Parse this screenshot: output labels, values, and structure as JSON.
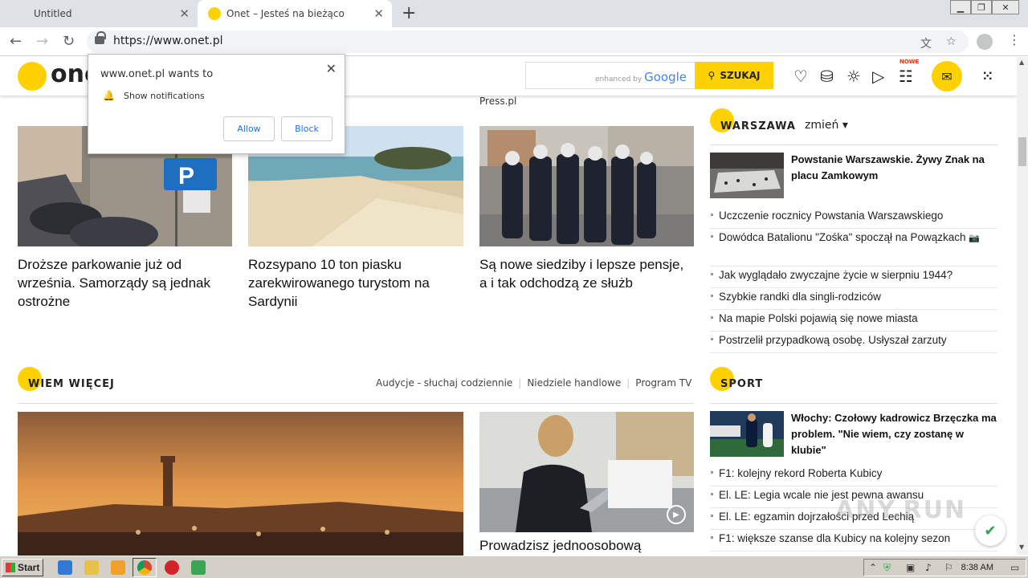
{
  "browser": {
    "tabs": [
      {
        "title": "Untitled"
      },
      {
        "title": "Onet – Jesteś na bieżąco"
      }
    ],
    "url": "https://www.onet.pl",
    "new_tab_glyph": "+",
    "close_glyph": "✕"
  },
  "onet_header": {
    "logo": "onet",
    "search_hint_prefix": "enhanced by",
    "search_hint_brand": "Google",
    "search_button": "SZUKAJ",
    "nowe_badge": "NOWE"
  },
  "notification": {
    "title": "www.onet.pl wants to",
    "message": "Show notifications",
    "allow": "Allow",
    "block": "Block"
  },
  "main": {
    "press_label": "Press.pl",
    "articles": [
      {
        "title": "Droższe parkowanie już od września. Samorządy są jednak ostrożne",
        "image": "parking-street-photo"
      },
      {
        "title": "Rozsypano 10 ton piasku zarekwirowanego turystom na Sardynii",
        "image": "beach-photo"
      },
      {
        "title": "Są nowe siedziby i lepsze pensje, a i tak odchodzą ze służb",
        "image": "police-photo"
      }
    ],
    "wiem_wiecej": {
      "label": "WIEM WIĘCEJ",
      "links": [
        "Audycje - słuchaj codziennie",
        "Niedziele handlowe",
        "Program TV"
      ],
      "mid_title": "Prowadzisz jednoosobową"
    }
  },
  "right": {
    "warszawa": {
      "label": "WARSZAWA",
      "change": "zmień ▾",
      "lead": "Powstanie Warszawskie. Żywy Znak na placu Zamkowym",
      "items": [
        "Uczczenie rocznicy Powstania Warszawskiego",
        "Dowódca Batalionu \"Zośka\" spoczął na Powązkach",
        "Jak wyglądało zwyczajne życie w sierpniu 1944?",
        "Szybkie randki dla singli-rodziców",
        "Na mapie Polski pojawią się nowe miasta",
        "Postrzelił przypadkową osobę. Usłyszał zarzuty"
      ]
    },
    "sport": {
      "label": "SPORT",
      "lead": "Włochy: Czołowy kadrowicz Brzęczka ma problem. \"Nie wiem, czy zostanę w klubie\"",
      "items": [
        "F1: kolejny rekord Roberta Kubicy",
        "El. LE: Legia wcale nie jest pewna awansu",
        "El. LE: egzamin dojrzałości przed Lechią",
        "F1: większe szanse dla Kubicy na kolejny sezon"
      ]
    }
  },
  "watermark": "ANY.RUN",
  "taskbar": {
    "start": "Start",
    "clock": "8:38 AM"
  }
}
